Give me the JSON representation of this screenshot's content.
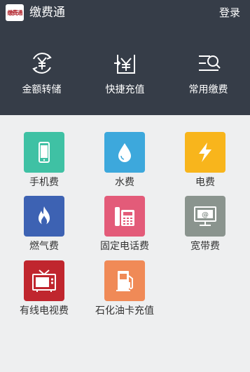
{
  "header": {
    "logo_text": "缴费通",
    "title": "缴费通",
    "login_label": "登录",
    "background": "#363d48"
  },
  "quick_actions": [
    {
      "label": "金额转储",
      "icon": "yuan-transfer-icon"
    },
    {
      "label": "快捷充值",
      "icon": "yuan-recharge-icon"
    },
    {
      "label": "常用缴费",
      "icon": "list-search-icon"
    }
  ],
  "services": [
    {
      "label": "手机费",
      "icon": "mobile-phone-icon",
      "color": "#3fc1a4"
    },
    {
      "label": "水费",
      "icon": "water-drop-icon",
      "color": "#3da8dc"
    },
    {
      "label": "电费",
      "icon": "lightning-icon",
      "color": "#f8b51c"
    },
    {
      "label": "燃气费",
      "icon": "flame-icon",
      "color": "#3d62b3"
    },
    {
      "label": "固定电话费",
      "icon": "landline-phone-icon",
      "color": "#e35b79"
    },
    {
      "label": "宽带费",
      "icon": "monitor-at-icon",
      "color": "#8a948e"
    },
    {
      "label": "有线电视费",
      "icon": "tv-icon",
      "color": "#c0262e"
    },
    {
      "label": "石化油卡充值",
      "icon": "fuel-pump-icon",
      "color": "#f08a57"
    }
  ]
}
